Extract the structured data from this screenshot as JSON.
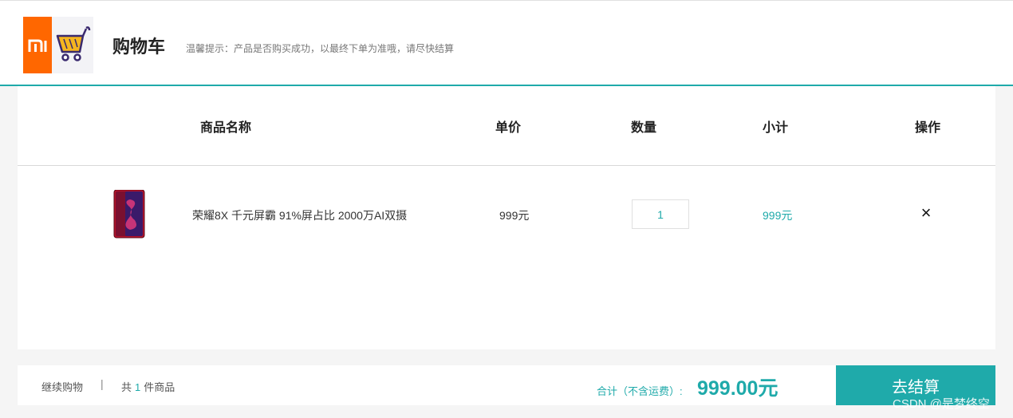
{
  "header": {
    "title": "购物车",
    "tip": "温馨提示：产品是否购买成功，以最终下单为准哦，请尽快结算",
    "brand_color": "#ff6700",
    "accent_color": "#1faaaa"
  },
  "table": {
    "columns": [
      "商品名称",
      "单价",
      "数量",
      "小计",
      "操作"
    ],
    "items": [
      {
        "name": "荣耀8X 千元屏霸 91%屏占比 2000万AI双摄",
        "price": "999元",
        "quantity": "1",
        "subtotal": "999元",
        "remove_icon": "×"
      }
    ]
  },
  "footer": {
    "continue_label": "继续购物",
    "separator": "|",
    "count_prefix": "共",
    "count_value": "1",
    "count_suffix": "件商品",
    "total_label": "合计（不含运费）:",
    "total_value": "999.00元",
    "checkout_label": "去结算"
  },
  "watermark": "CSDN @是梦终空"
}
